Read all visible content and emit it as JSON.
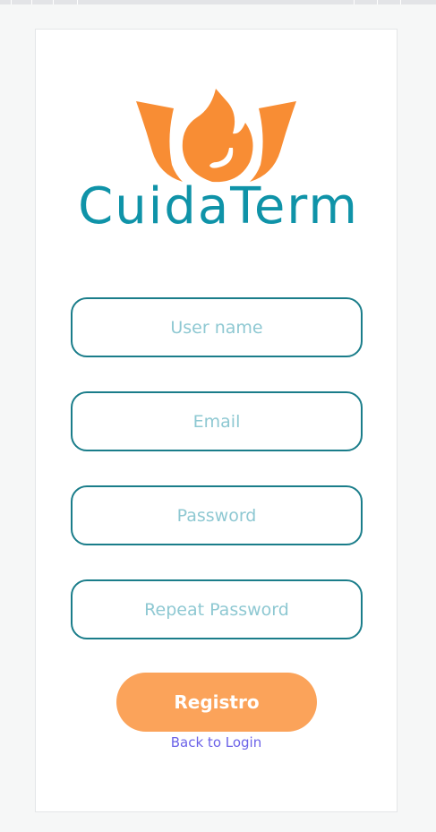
{
  "app": {
    "brand_name": "CuidaTerm"
  },
  "colors": {
    "brand_teal": "#0f93a8",
    "brand_orange": "#f88d34",
    "field_border": "#1a7d8a",
    "placeholder": "#8ec8d2",
    "button_bg": "#fba35a",
    "link": "#6c63e8"
  },
  "form": {
    "username": {
      "placeholder": "User name",
      "value": ""
    },
    "email": {
      "placeholder": "Email",
      "value": ""
    },
    "password": {
      "placeholder": "Password",
      "value": ""
    },
    "repeat_password": {
      "placeholder": "Repeat Password",
      "value": ""
    },
    "submit_label": "Registro",
    "back_link_label": "Back to Login"
  }
}
